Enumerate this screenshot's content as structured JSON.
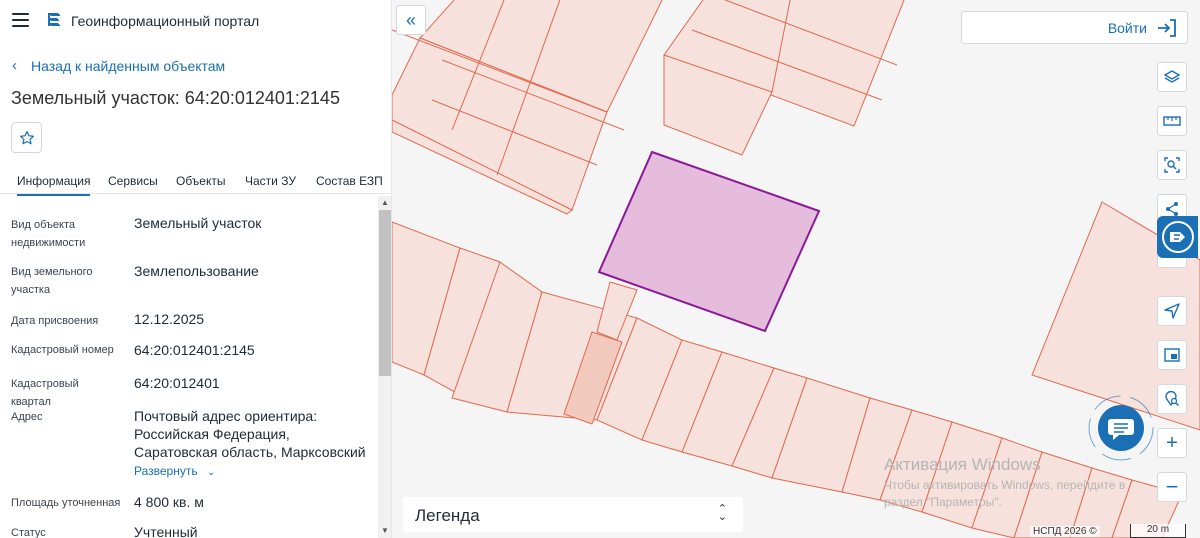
{
  "header": {
    "portal_title": "Геоинформационный портал"
  },
  "navigation": {
    "back_label": "Назад к найденным объектам"
  },
  "object": {
    "title": "Земельный участок: 64:20:012401:2145"
  },
  "tabs": [
    {
      "label": "Информация",
      "active": true
    },
    {
      "label": "Сервисы",
      "active": false
    },
    {
      "label": "Объекты",
      "active": false
    },
    {
      "label": "Части ЗУ",
      "active": false
    },
    {
      "label": "Состав ЕЗП",
      "active": false
    }
  ],
  "properties": [
    {
      "label": "Вид объекта недвижимости",
      "value": "Земельный участок"
    },
    {
      "label": "Вид земельного участка",
      "value": "Землепользование"
    },
    {
      "label": "Дата присвоения",
      "value": "12.12.2025"
    },
    {
      "label": "Кадастровый номер",
      "value": "64:20:012401:2145"
    },
    {
      "label": "Кадастровый квартал",
      "value": "64:20:012401"
    },
    {
      "label": "Адрес",
      "value": "Почтовый адрес ориентира: Российская Федерация, Саратовская область, Марксовский"
    },
    {
      "label": "Площадь уточненная",
      "value": "4 800 кв. м"
    },
    {
      "label": "Статус",
      "value": "Учтенный"
    }
  ],
  "address_expand_label": "Развернуть",
  "map": {
    "login_label": "Войти",
    "legend_label": "Легенда",
    "watermark_title": "Активация Windows",
    "watermark_text": "Чтобы активировать Windows, перейдите в раздел \"Параметры\".",
    "attribution": "НСПД 2026 ©",
    "scale_label": "20 m",
    "tools": [
      "layers-icon",
      "ruler-icon",
      "select-area-icon",
      "share-icon",
      "geolocation-icon",
      "minimap-icon",
      "location-search-icon",
      "zoom-in-icon",
      "zoom-out-icon"
    ]
  },
  "colors": {
    "accent": "#1a6fb5",
    "parcel_fill": "#f7e1dc",
    "parcel_stroke": "#e06a4f",
    "selected_fill": "#e6bcdc",
    "selected_stroke": "#8b1a99"
  }
}
